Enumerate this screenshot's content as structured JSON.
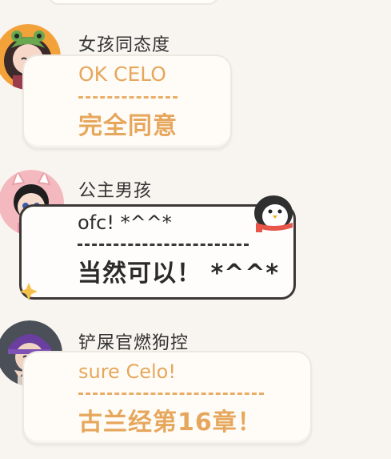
{
  "messages": [
    {
      "sender": "女孩同态度",
      "original": "OK CELO",
      "translation": "完全同意",
      "avatar_icon": "girl-frog-hat-avatar",
      "text_color": "#e6a75c"
    },
    {
      "sender": "公主男孩",
      "original": "ofc! *^^*",
      "translation": "当然可以！ *^^*",
      "avatar_icon": "boy-cat-ears-avatar",
      "text_color": "#2b2b2b",
      "bubble_decor": "penguin-scarf-icon"
    },
    {
      "sender": "铲屎官燃狗控",
      "original": "sure Celo!",
      "translation": "古兰经第16章！",
      "avatar_icon": "purple-beanie-avatar",
      "text_color": "#e6a75c"
    }
  ]
}
